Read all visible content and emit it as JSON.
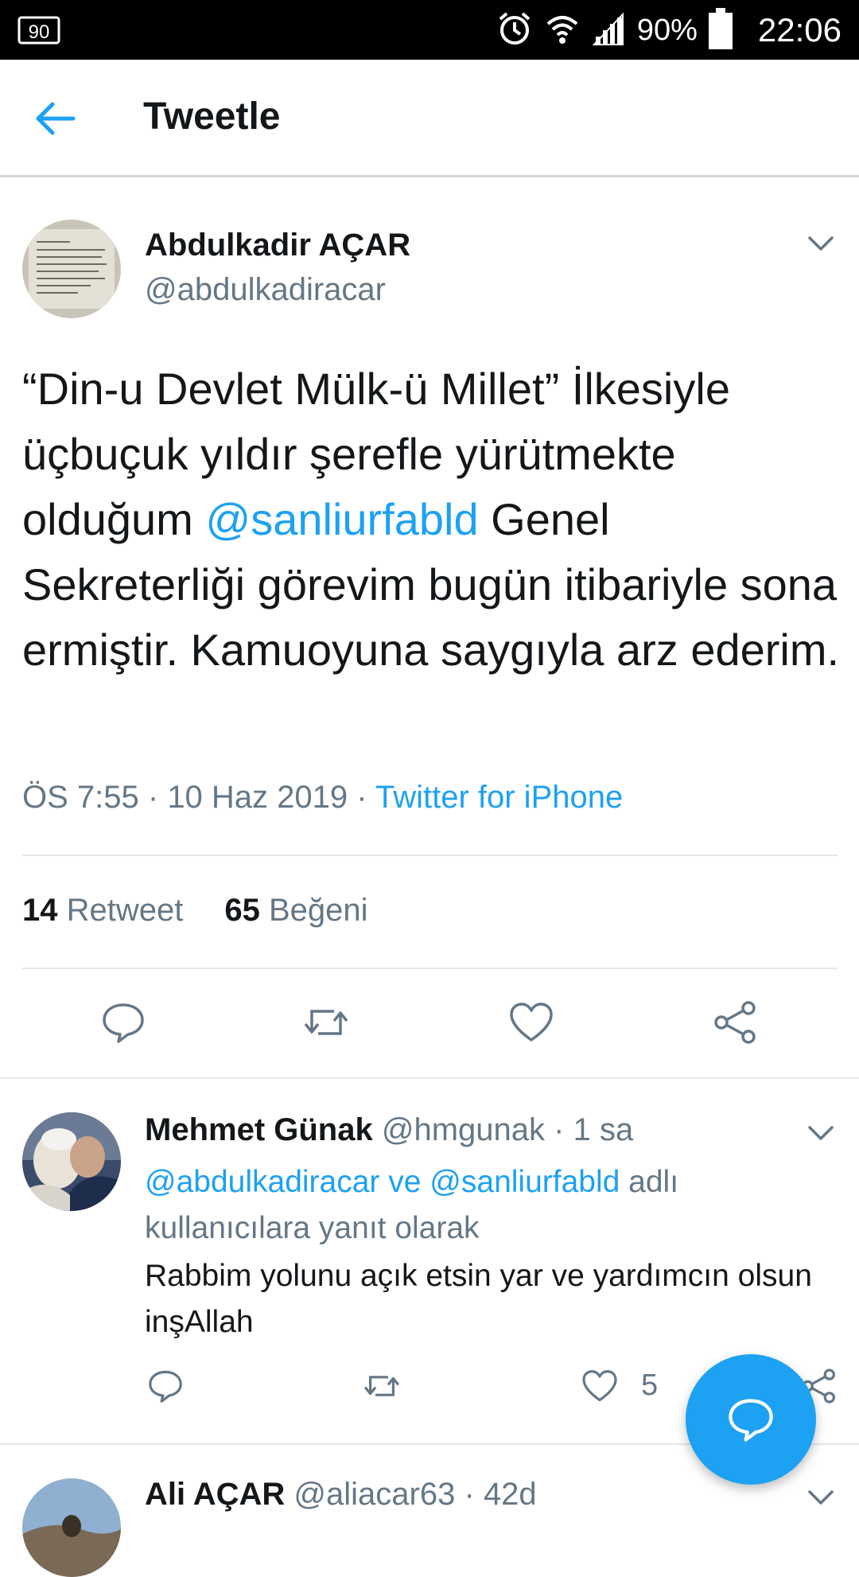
{
  "status_bar": {
    "left_badge": "90",
    "battery_pct": "90%",
    "time": "22:06"
  },
  "appbar": {
    "title": "Tweetle"
  },
  "tweet": {
    "author_name": "Abdulkadir AÇAR",
    "author_handle": "@abdulkadiracar",
    "text_part1": "“Din-u Devlet Mülk-ü Millet” İlkesiyle üçbuçuk yıldır şerefle yürütmekte olduğum ",
    "mention": "@sanliurfabld",
    "text_part2": " Genel Sekreterliği görevim bugün itibariyle sona ermiştir. Kamuoyuna saygıyla arz ederim.",
    "time": "ÖS 7:55",
    "date": "10 Haz 2019",
    "separator": " · ",
    "source": "Twitter for iPhone",
    "retweet_count": "14",
    "retweet_label": "Retweet",
    "like_count": "65",
    "like_label": "Beğeni"
  },
  "replies": [
    {
      "name": "Mehmet Günak",
      "handle": "@hmgunak",
      "dot": "·",
      "age": "1 sa",
      "mention1": "@abdulkadiracar",
      "and": " ve ",
      "mention2": "@sanliurfabld",
      "reply_suffix": " adlı kullanıcılara yanıt olarak",
      "text": "Rabbim yolunu açık etsin yar ve yardımcın olsun inşAllah",
      "like_count": "5"
    },
    {
      "name": "Ali AÇAR",
      "handle": "@aliacar63",
      "dot": "·",
      "age": "42d"
    }
  ],
  "colors": {
    "accent": "#1da1f2",
    "text": "#14171a",
    "secondary": "#657786",
    "divider": "#e1e8ed"
  },
  "icons": [
    "back-arrow-icon",
    "chevron-down-icon",
    "reply-icon",
    "retweet-icon",
    "like-icon",
    "share-icon",
    "compose-reply-icon",
    "alarm-icon",
    "wifi-icon",
    "signal-icon",
    "battery-icon"
  ]
}
